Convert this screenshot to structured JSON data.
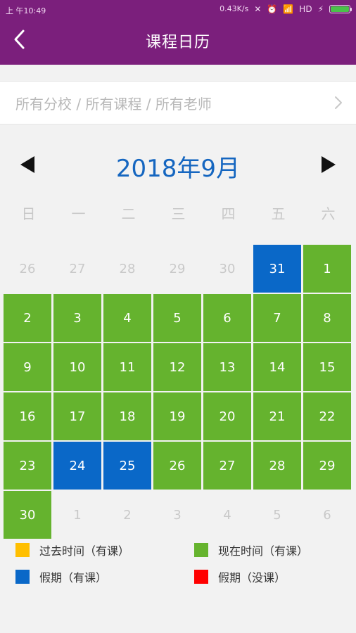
{
  "status_bar": {
    "left_text": "上 午10:49",
    "network_speed": "0.43K/s",
    "battery_level": 1.0
  },
  "app_bar": {
    "title": "课程日历",
    "back_icon": "chevron-left-icon",
    "bg_color": "#7b1f7c"
  },
  "filter": {
    "text": "所有分校 / 所有课程 / 所有老师",
    "chevron_icon": "chevron-right-icon"
  },
  "calendar": {
    "month_title": "2018年9月",
    "prev_icon": "triangle-left-icon",
    "next_icon": "triangle-right-icon",
    "weekdays": [
      "日",
      "一",
      "二",
      "三",
      "四",
      "五",
      "六"
    ],
    "days": [
      {
        "label": "26",
        "status": "other"
      },
      {
        "label": "27",
        "status": "other"
      },
      {
        "label": "28",
        "status": "other"
      },
      {
        "label": "29",
        "status": "other"
      },
      {
        "label": "30",
        "status": "other"
      },
      {
        "label": "31",
        "status": "holiday"
      },
      {
        "label": "1",
        "status": "present"
      },
      {
        "label": "2",
        "status": "present"
      },
      {
        "label": "3",
        "status": "present"
      },
      {
        "label": "4",
        "status": "present"
      },
      {
        "label": "5",
        "status": "present"
      },
      {
        "label": "6",
        "status": "present"
      },
      {
        "label": "7",
        "status": "present"
      },
      {
        "label": "8",
        "status": "present"
      },
      {
        "label": "9",
        "status": "present"
      },
      {
        "label": "10",
        "status": "present"
      },
      {
        "label": "11",
        "status": "present"
      },
      {
        "label": "12",
        "status": "present"
      },
      {
        "label": "13",
        "status": "present"
      },
      {
        "label": "14",
        "status": "present"
      },
      {
        "label": "15",
        "status": "present"
      },
      {
        "label": "16",
        "status": "present"
      },
      {
        "label": "17",
        "status": "present"
      },
      {
        "label": "18",
        "status": "present"
      },
      {
        "label": "19",
        "status": "present"
      },
      {
        "label": "20",
        "status": "present"
      },
      {
        "label": "21",
        "status": "present"
      },
      {
        "label": "22",
        "status": "present"
      },
      {
        "label": "23",
        "status": "present"
      },
      {
        "label": "24",
        "status": "holiday"
      },
      {
        "label": "25",
        "status": "holiday"
      },
      {
        "label": "26",
        "status": "present"
      },
      {
        "label": "27",
        "status": "present"
      },
      {
        "label": "28",
        "status": "present"
      },
      {
        "label": "29",
        "status": "present"
      },
      {
        "label": "30",
        "status": "present"
      },
      {
        "label": "1",
        "status": "other"
      },
      {
        "label": "2",
        "status": "other"
      },
      {
        "label": "3",
        "status": "other"
      },
      {
        "label": "4",
        "status": "other"
      },
      {
        "label": "5",
        "status": "other"
      },
      {
        "label": "6",
        "status": "other"
      }
    ]
  },
  "legend": [
    {
      "label": "过去时间（有课）",
      "color": "#ffbf00"
    },
    {
      "label": "现在时间（有课）",
      "color": "#65b32e"
    },
    {
      "label": "假期（有课）",
      "color": "#0a68c8"
    },
    {
      "label": "假期（没课）",
      "color": "#ff0000"
    }
  ],
  "colors": {
    "accent_blue": "#1566c0",
    "present_green": "#65b32e",
    "holiday_blue": "#0a68c8",
    "other_text": "#c9c9c9"
  }
}
